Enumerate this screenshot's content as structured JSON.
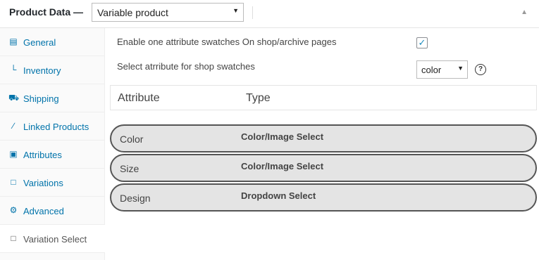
{
  "header": {
    "title": "Product Data —",
    "product_type": "Variable product",
    "collapse_icon": "triangle-up-icon"
  },
  "sidebar": {
    "items": [
      {
        "label": "General",
        "icon": "general-icon",
        "glyph": "▤"
      },
      {
        "label": "Inventory",
        "icon": "inventory-icon",
        "glyph": "└"
      },
      {
        "label": "Shipping",
        "icon": "truck-icon",
        "glyph": "⛟"
      },
      {
        "label": "Linked Products",
        "icon": "link-icon",
        "glyph": "∕"
      },
      {
        "label": "Attributes",
        "icon": "attributes-icon",
        "glyph": "▣"
      },
      {
        "label": "Variations",
        "icon": "variations-icon",
        "glyph": "□"
      },
      {
        "label": "Advanced",
        "icon": "gear-icon",
        "glyph": "⚙"
      },
      {
        "label": "Variation Select",
        "icon": "window-icon",
        "glyph": "□",
        "active": true
      }
    ]
  },
  "main": {
    "enable_label": "Enable one attribute swatches On shop/archive pages",
    "enable_checked": true,
    "select_label": "Select atrribute for shop swatches",
    "select_value": "color",
    "columns": {
      "attribute": "Attribute",
      "type": "Type"
    },
    "attributes": [
      {
        "name": "Color",
        "type": "Color/Image Select"
      },
      {
        "name": "Size",
        "type": "Color/Image Select"
      },
      {
        "name": "Design",
        "type": "Dropdown Select"
      }
    ]
  },
  "colors": {
    "link": "#0073aa",
    "check": "#1e8cbe",
    "row_bg": "#e4e4e4",
    "row_border": "#555555"
  }
}
